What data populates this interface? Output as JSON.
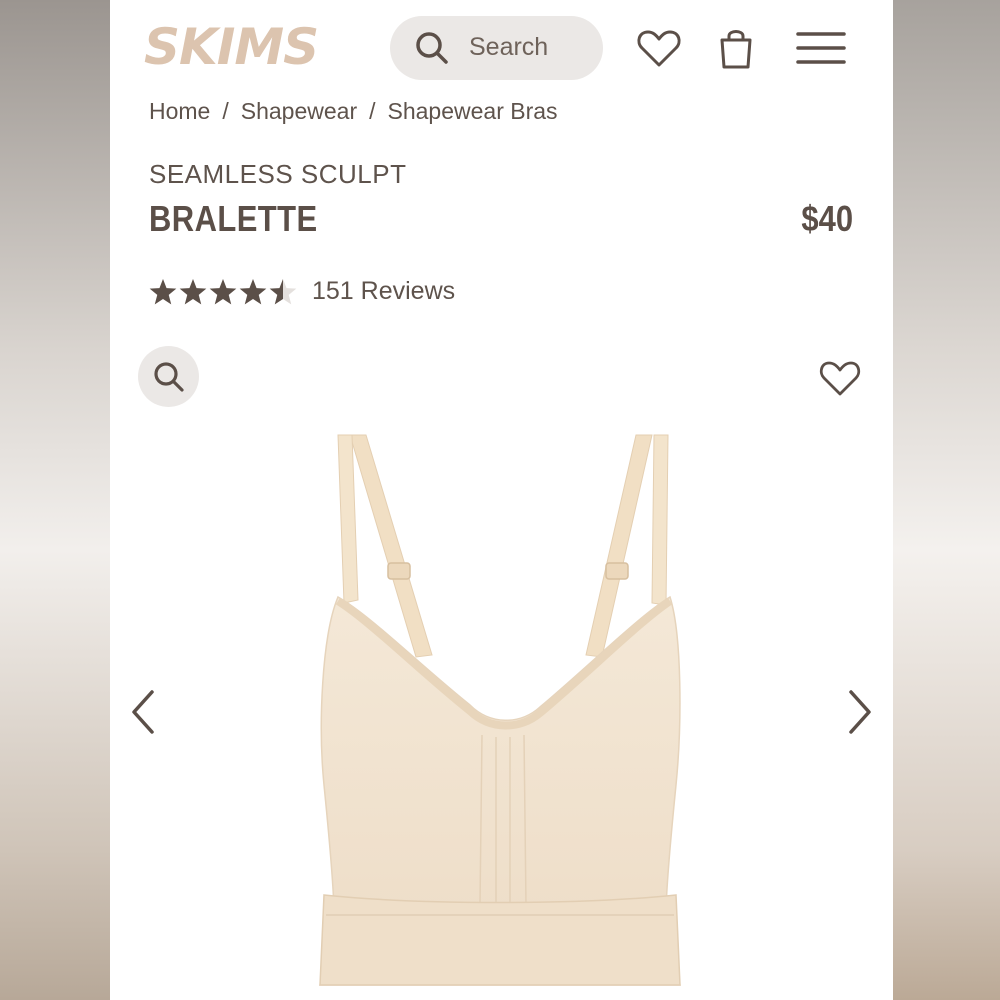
{
  "header": {
    "logo_text": "SKIMS",
    "search_placeholder": "Search",
    "icons": [
      "search-icon",
      "heart-icon",
      "shopping-bag-icon",
      "hamburger-menu-icon"
    ]
  },
  "breadcrumb": [
    "Home",
    "Shapewear",
    "Shapewear Bras"
  ],
  "breadcrumb_separator": "/",
  "product": {
    "collection": "SEAMLESS SCULPT",
    "name": "BRALETTE",
    "price": "$40",
    "rating": 4.5,
    "rating_max": 5,
    "reviews_label": "151 Reviews"
  },
  "gallery": {
    "icons": [
      "zoom-icon",
      "heart-icon",
      "chevron-left-icon",
      "chevron-right-icon"
    ]
  },
  "colors": {
    "brand": "#dcc4af",
    "text": "#5b4f48",
    "pill_bg": "#ebe8e6",
    "product": "#f2e3cf"
  }
}
